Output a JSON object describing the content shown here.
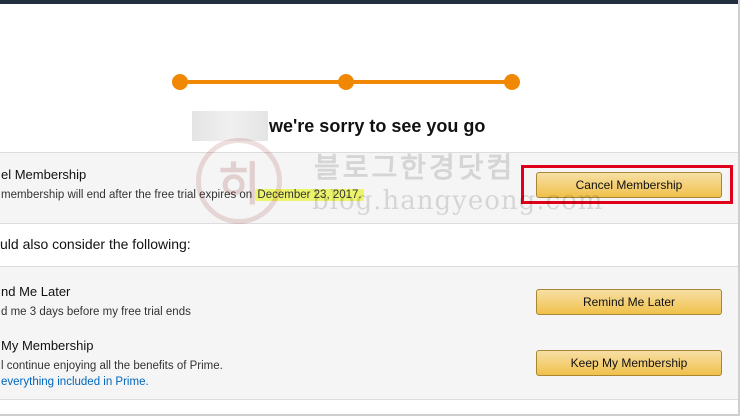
{
  "progress": {
    "steps": 3
  },
  "heading": {
    "text": "we're sorry to see you go"
  },
  "cancel_section": {
    "title": "el Membership",
    "desc_before": "membership will end after the free trial expires on",
    "end_date": "December 23, 2017.",
    "button_label": "Cancel Membership"
  },
  "consider_text": "uld also consider the following:",
  "options": {
    "remind": {
      "title": "nd Me Later",
      "desc": "d me 3 days before my free trial ends",
      "button_label": "Remind Me Later"
    },
    "keep": {
      "title": "My Membership",
      "desc": "l continue enjoying all the benefits of Prime.",
      "link": "everything included in Prime.",
      "button_label": "Keep My Membership"
    }
  },
  "watermark": {
    "glyph": "히",
    "korean": "블로그한경닷컴",
    "url": "blog.hangyeong.com"
  },
  "colors": {
    "accent": "#f08804",
    "highlight": "#ecf46c",
    "annotation_red": "#e0001b",
    "link": "#0066c0"
  }
}
